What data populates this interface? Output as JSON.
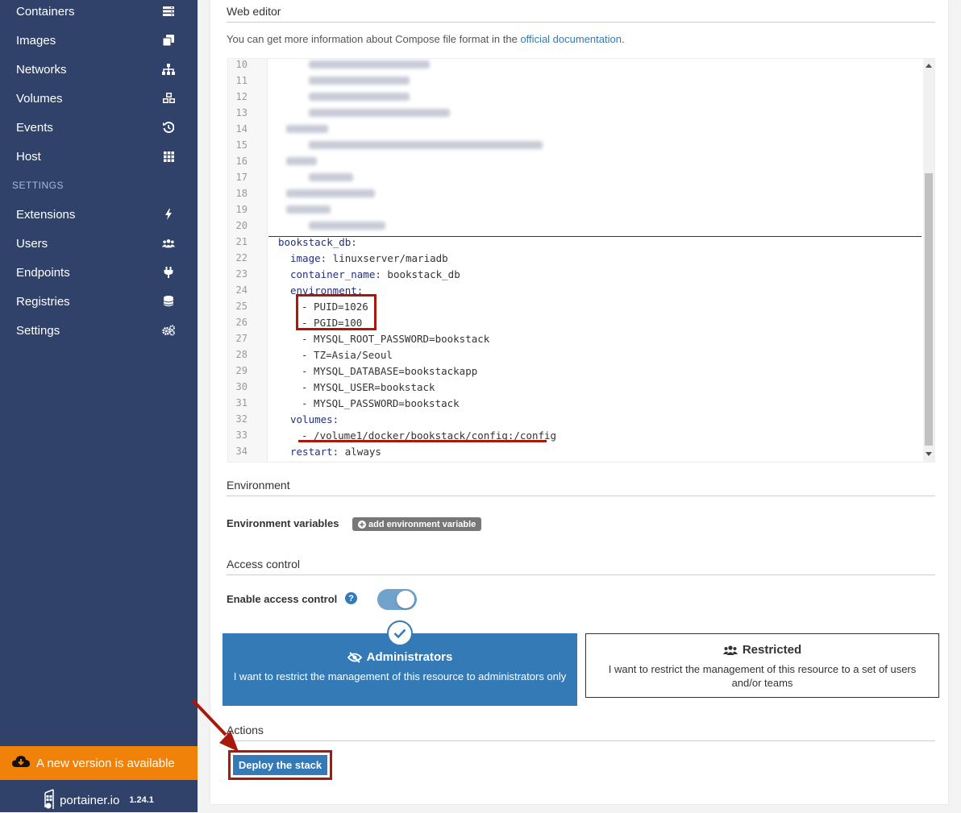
{
  "sidebar": {
    "items": [
      {
        "label": "Containers",
        "icon": "containers-icon"
      },
      {
        "label": "Images",
        "icon": "images-icon"
      },
      {
        "label": "Networks",
        "icon": "sitemap-icon"
      },
      {
        "label": "Volumes",
        "icon": "cubes-icon"
      },
      {
        "label": "Events",
        "icon": "history-icon"
      },
      {
        "label": "Host",
        "icon": "grid-icon"
      }
    ],
    "settings_title": "SETTINGS",
    "settings_items": [
      {
        "label": "Extensions",
        "icon": "bolt-icon"
      },
      {
        "label": "Users",
        "icon": "users-icon"
      },
      {
        "label": "Endpoints",
        "icon": "plug-icon"
      },
      {
        "label": "Registries",
        "icon": "database-icon"
      },
      {
        "label": "Settings",
        "icon": "cogs-icon"
      }
    ],
    "update_banner": "A new version is available",
    "footer_brand": "portainer.io",
    "footer_version": "1.24.1"
  },
  "web_editor": {
    "title": "Web editor",
    "help_prefix": "You can get more information about Compose file format in the ",
    "help_link": "official documentation",
    "help_suffix": ".",
    "line_numbers": [
      "10",
      "11",
      "12",
      "13",
      "14",
      "15",
      "16",
      "17",
      "18",
      "19",
      "20",
      "21",
      "22",
      "23",
      "24",
      "25",
      "26",
      "27",
      "28",
      "29",
      "30",
      "31",
      "32",
      "33",
      "34"
    ],
    "code": {
      "l21": "bookstack_db:",
      "l22_key": "image:",
      "l22_val": " linuxserver/mariadb",
      "l23_key": "container_name:",
      "l23_val": " bookstack_db",
      "l24_key": "environment:",
      "l25": "- PUID=1026",
      "l26": "- PGID=100",
      "l27": "- MYSQL_ROOT_PASSWORD=bookstack",
      "l28": "- TZ=Asia/Seoul",
      "l29": "- MYSQL_DATABASE=bookstackapp",
      "l30": "- MYSQL_USER=bookstack",
      "l31": "- MYSQL_PASSWORD=bookstack",
      "l32_key": "volumes:",
      "l33": "- /volume1/docker/bookstack/config:/config",
      "l34_key": "restart:",
      "l34_val": " always"
    }
  },
  "environment": {
    "title": "Environment",
    "vars_label": "Environment variables",
    "add_button": "add environment variable"
  },
  "access_control": {
    "title": "Access control",
    "enable_label": "Enable access control",
    "enabled": true,
    "admin_title": "Administrators",
    "admin_desc": "I want to restrict the management of this resource to administrators only",
    "restricted_title": "Restricted",
    "restricted_desc": "I want to restrict the management of this resource to a set of users and/or teams"
  },
  "actions": {
    "title": "Actions",
    "deploy_button": "Deploy the stack"
  },
  "colors": {
    "sidebar": "#30426a",
    "accent": "#337ab7",
    "banner": "#f0820a",
    "annotation": "#a8190b"
  }
}
